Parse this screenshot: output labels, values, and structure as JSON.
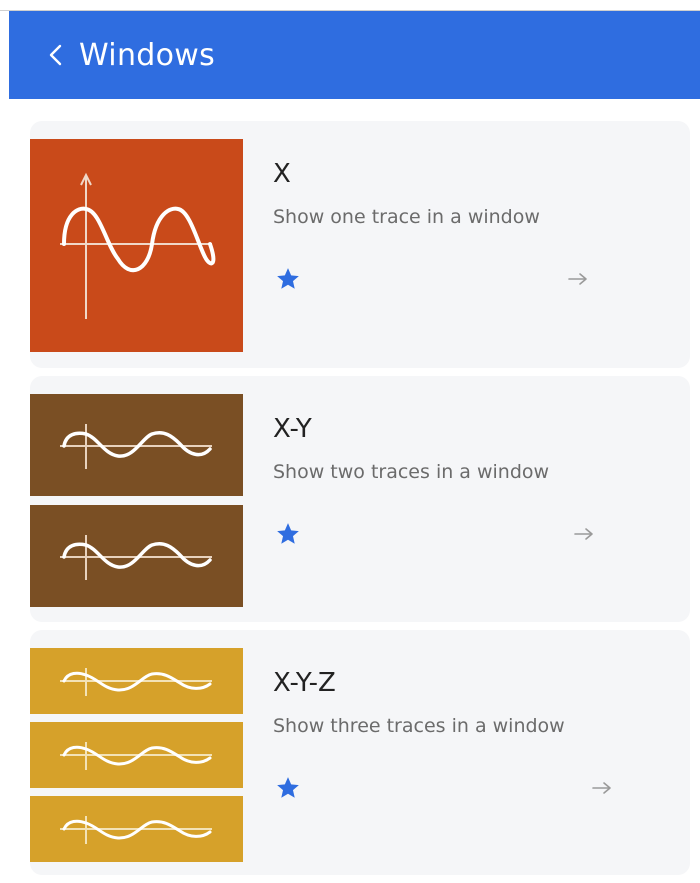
{
  "colors": {
    "header": "#2f6de0",
    "favorite": "#2f6de0",
    "arrow": "#9a9a9a",
    "card_bg": "#f5f6f8"
  },
  "header": {
    "back_icon": "chevron-left-icon",
    "title": "Windows"
  },
  "items": [
    {
      "title": "X",
      "description": "Show one trace in a window",
      "traces": 1,
      "thumbnail_color": "#c94a1a",
      "favorite": true,
      "arrow_icon": "arrow-right-icon"
    },
    {
      "title": "X-Y",
      "description": "Show two traces in a window",
      "traces": 2,
      "thumbnail_color": "#7a4f24",
      "favorite": true,
      "arrow_icon": "arrow-right-icon"
    },
    {
      "title": "X-Y-Z",
      "description": "Show three traces in a window",
      "traces": 3,
      "thumbnail_color": "#d6a12a",
      "favorite": true,
      "arrow_icon": "arrow-right-icon"
    }
  ]
}
